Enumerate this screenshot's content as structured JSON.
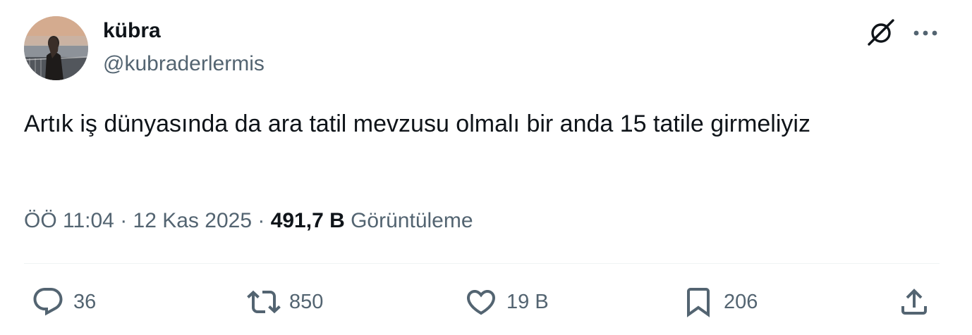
{
  "user": {
    "display_name": "kübra",
    "handle": "@kubraderlermis"
  },
  "tweet": {
    "text": "Artık iş dünyasında da ara tatil mevzusu olmalı bir anda 15 tatile girmeliyiz"
  },
  "meta": {
    "time": "ÖÖ 11:04",
    "separator1": " · ",
    "date": "12 Kas 2025",
    "separator2": " · ",
    "views_count": "491,7 B",
    "views_label": " Görüntüleme"
  },
  "actions": {
    "replies": "36",
    "retweets": "850",
    "likes": "19 B",
    "bookmarks": "206"
  },
  "icons": {
    "grok": "grok-icon",
    "more": "more-icon",
    "reply": "reply-icon",
    "retweet": "retweet-icon",
    "like": "heart-icon",
    "bookmark": "bookmark-icon",
    "share": "share-icon"
  },
  "colors": {
    "text_primary": "#0f1419",
    "text_secondary": "#536471",
    "divider": "#eff3f4"
  }
}
